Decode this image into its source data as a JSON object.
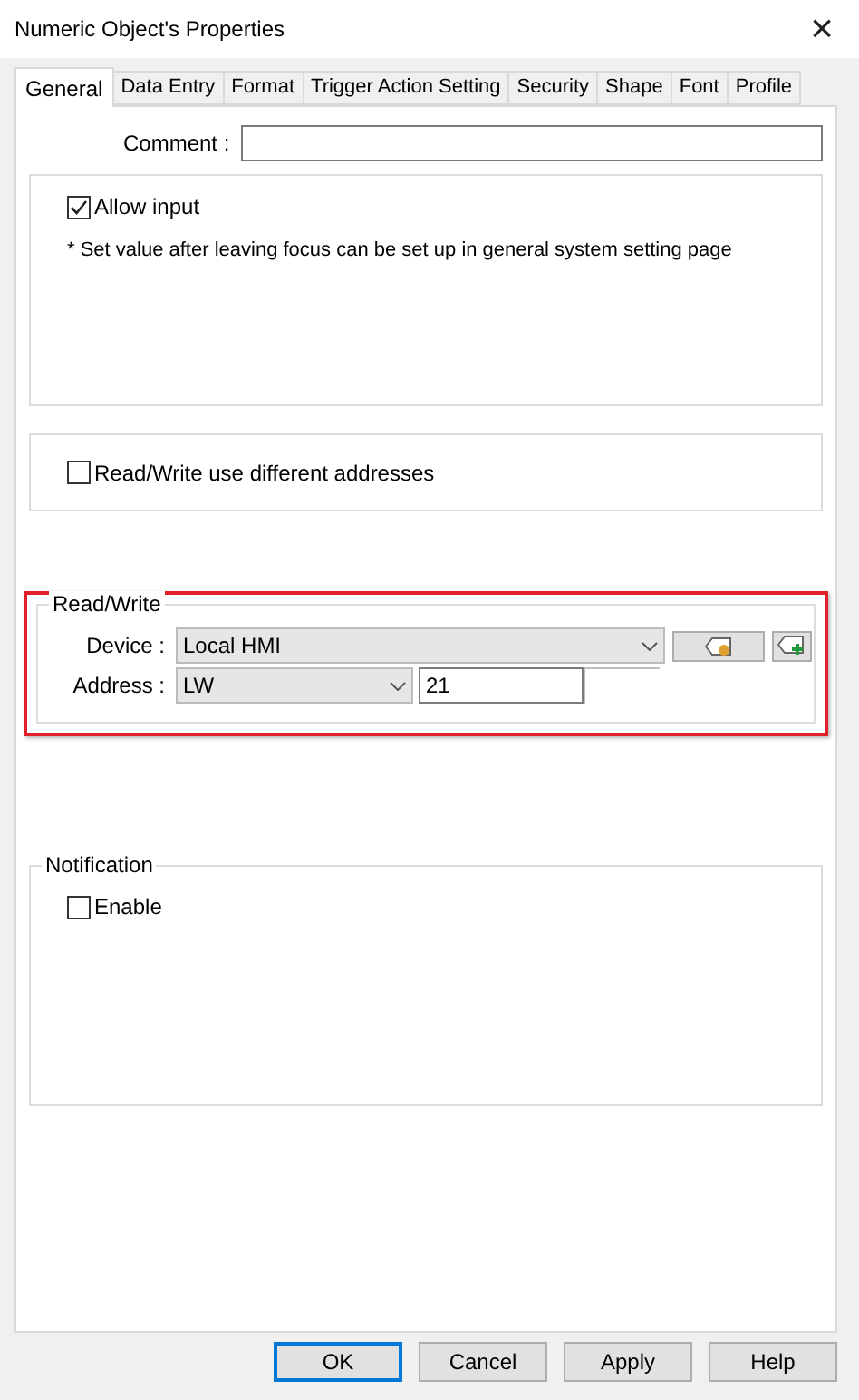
{
  "window": {
    "title": "Numeric Object's Properties",
    "close": "×"
  },
  "tabs": [
    {
      "label": "General",
      "selected": true
    },
    {
      "label": "Data Entry",
      "selected": false
    },
    {
      "label": "Format",
      "selected": false
    },
    {
      "label": "Trigger Action Setting",
      "selected": false
    },
    {
      "label": "Security",
      "selected": false
    },
    {
      "label": "Shape",
      "selected": false
    },
    {
      "label": "Font",
      "selected": false
    },
    {
      "label": "Profile",
      "selected": false
    }
  ],
  "comment": {
    "label": "Comment :"
  },
  "input_group": {
    "allow_input": {
      "label": "Allow input",
      "checked": true
    },
    "note": "* Set value after leaving focus can be set up in general system setting page"
  },
  "address_group": {
    "different_addresses": {
      "label": "Read/Write use different addresses",
      "checked": false
    }
  },
  "read_write": {
    "title": "Read/Write",
    "highlighted": true,
    "device_label": "Device :",
    "device": "Local HMI",
    "address_label": "Address :",
    "address_type": "LW",
    "address_value": "21"
  },
  "notification": {
    "title": "Notification",
    "enable": {
      "label": "Enable",
      "checked": false
    }
  },
  "buttons": [
    {
      "label": "OK",
      "default": true
    },
    {
      "label": "Cancel",
      "default": false
    },
    {
      "label": "Apply",
      "default": false
    },
    {
      "label": "Help",
      "default": false
    }
  ]
}
